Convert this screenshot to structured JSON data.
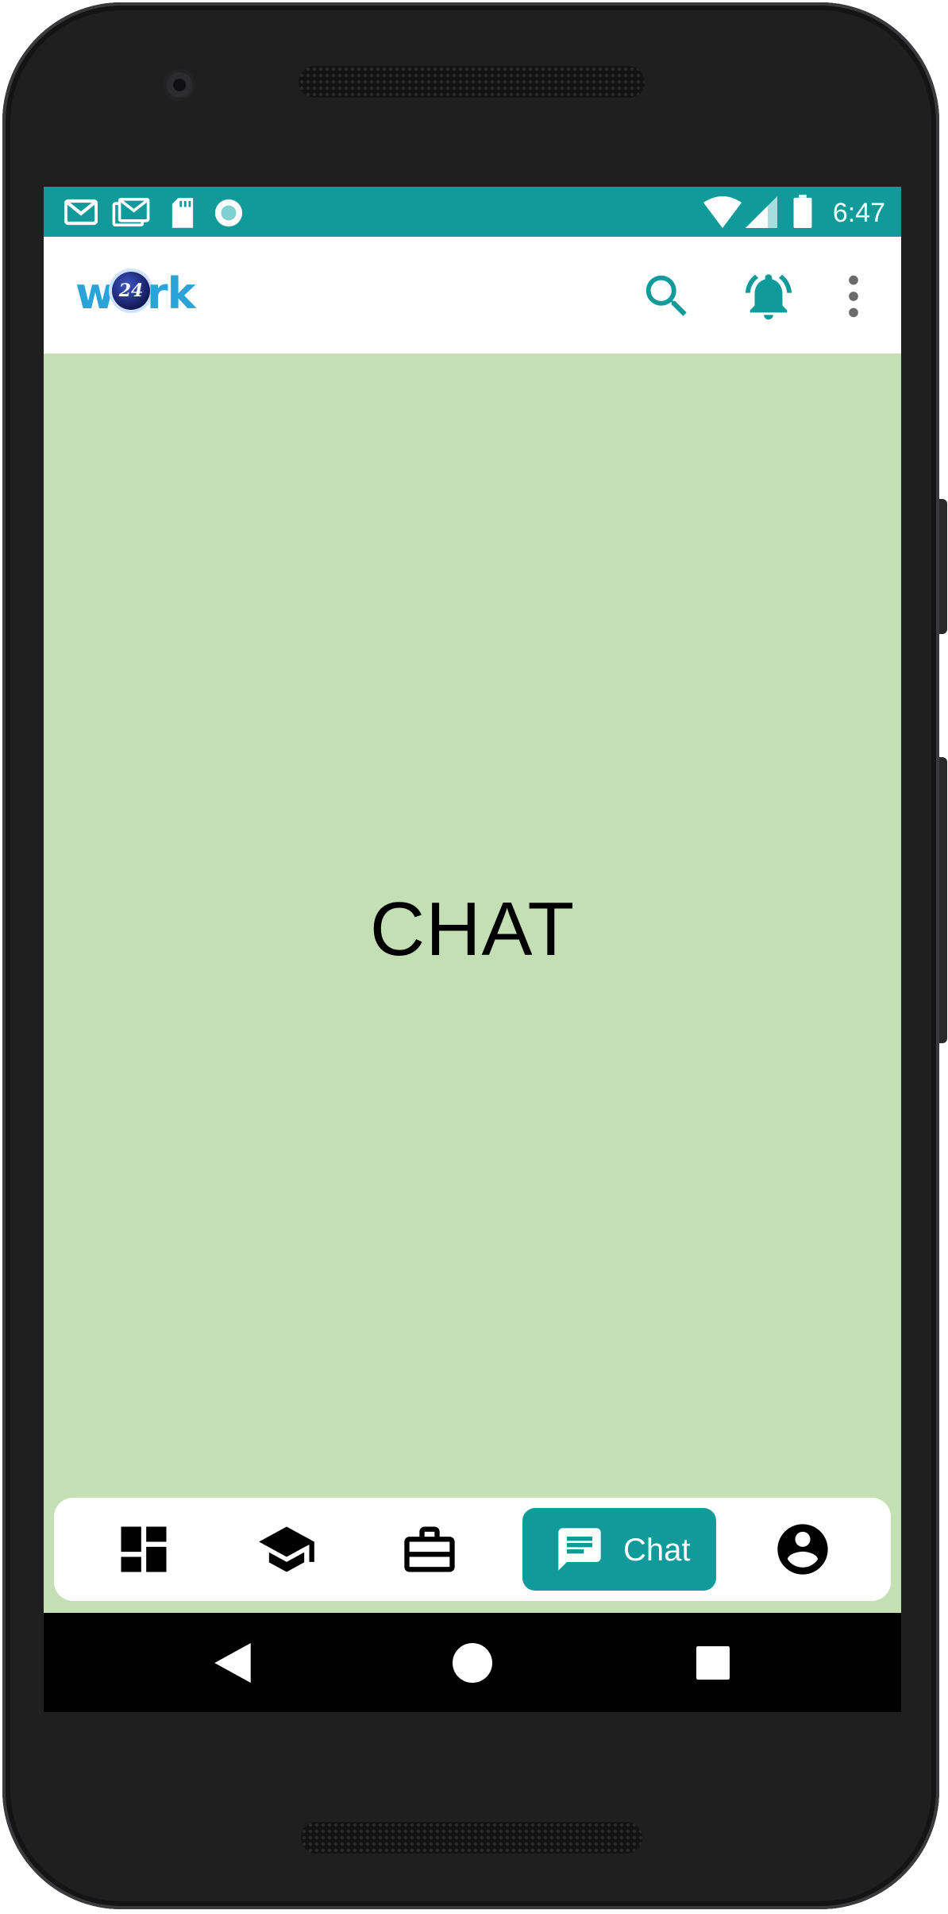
{
  "status_bar": {
    "time": "6:47",
    "icons": [
      "gmail-icon",
      "gmail-icon",
      "sd-card-icon",
      "record-icon",
      "wifi-icon",
      "signal-icon",
      "battery-icon"
    ]
  },
  "app_bar": {
    "logo_text_start": "w",
    "logo_badge": "24",
    "logo_text_end": "rk",
    "icons": [
      "search-icon",
      "bell-ring-icon",
      "more-vert-icon"
    ]
  },
  "main": {
    "title": "CHAT"
  },
  "bottom_nav": {
    "items": [
      {
        "icon": "dashboard-icon",
        "label": ""
      },
      {
        "icon": "graduation-cap-icon",
        "label": ""
      },
      {
        "icon": "briefcase-icon",
        "label": ""
      },
      {
        "icon": "chat-icon",
        "label": "Chat",
        "active": true
      },
      {
        "icon": "account-circle-icon",
        "label": ""
      }
    ]
  },
  "system_nav": {
    "icons": [
      "back-icon",
      "home-icon",
      "recents-icon"
    ]
  },
  "colors": {
    "primary": "#119a9a",
    "content_background": "#c4dfb4",
    "logo_blue": "#2aa3d9"
  }
}
